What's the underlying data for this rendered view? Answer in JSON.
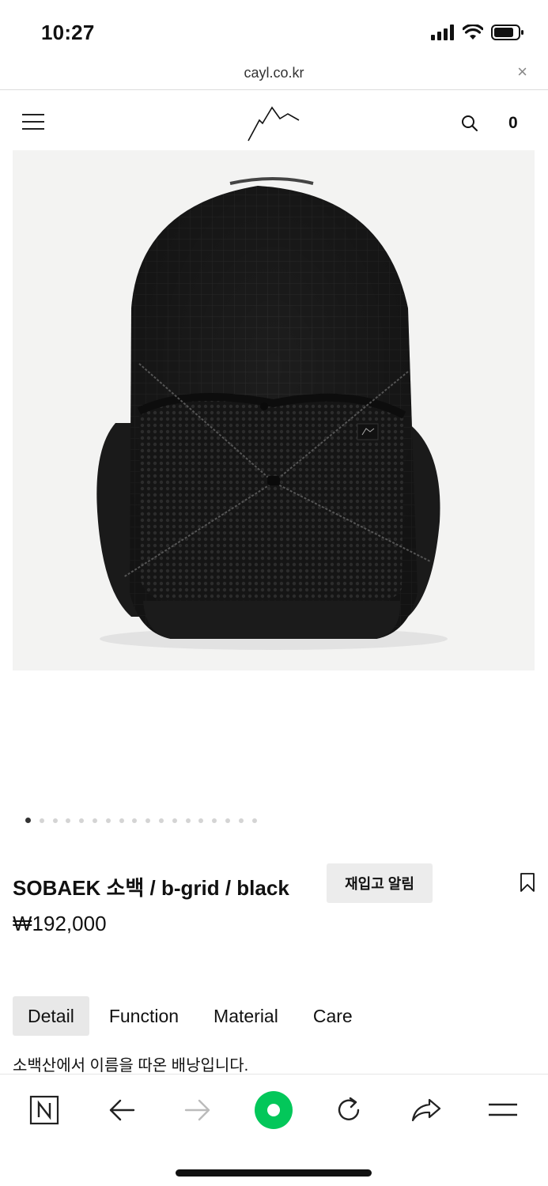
{
  "status_bar": {
    "time": "10:27"
  },
  "browser": {
    "url": "cayl.co.kr",
    "close_label": "×"
  },
  "header": {
    "cart_count": "0"
  },
  "carousel": {
    "total_images": 18,
    "active_index": 0
  },
  "product": {
    "name": "SOBAEK 소백 / b-grid / black",
    "restock_label": "재입고 알림",
    "price": "₩192,000"
  },
  "tabs": [
    {
      "label": "Detail",
      "active": true
    },
    {
      "label": "Function",
      "active": false
    },
    {
      "label": "Material",
      "active": false
    },
    {
      "label": "Care",
      "active": false
    }
  ],
  "description": "소백산에서 이름을 따온 배낭입니다.",
  "toolbar": {
    "items": [
      "naver-n-icon",
      "back-arrow-icon",
      "forward-arrow-icon",
      "green-home-icon",
      "reload-icon",
      "share-icon",
      "menu-icon"
    ],
    "accent_color": "#03c75a"
  }
}
